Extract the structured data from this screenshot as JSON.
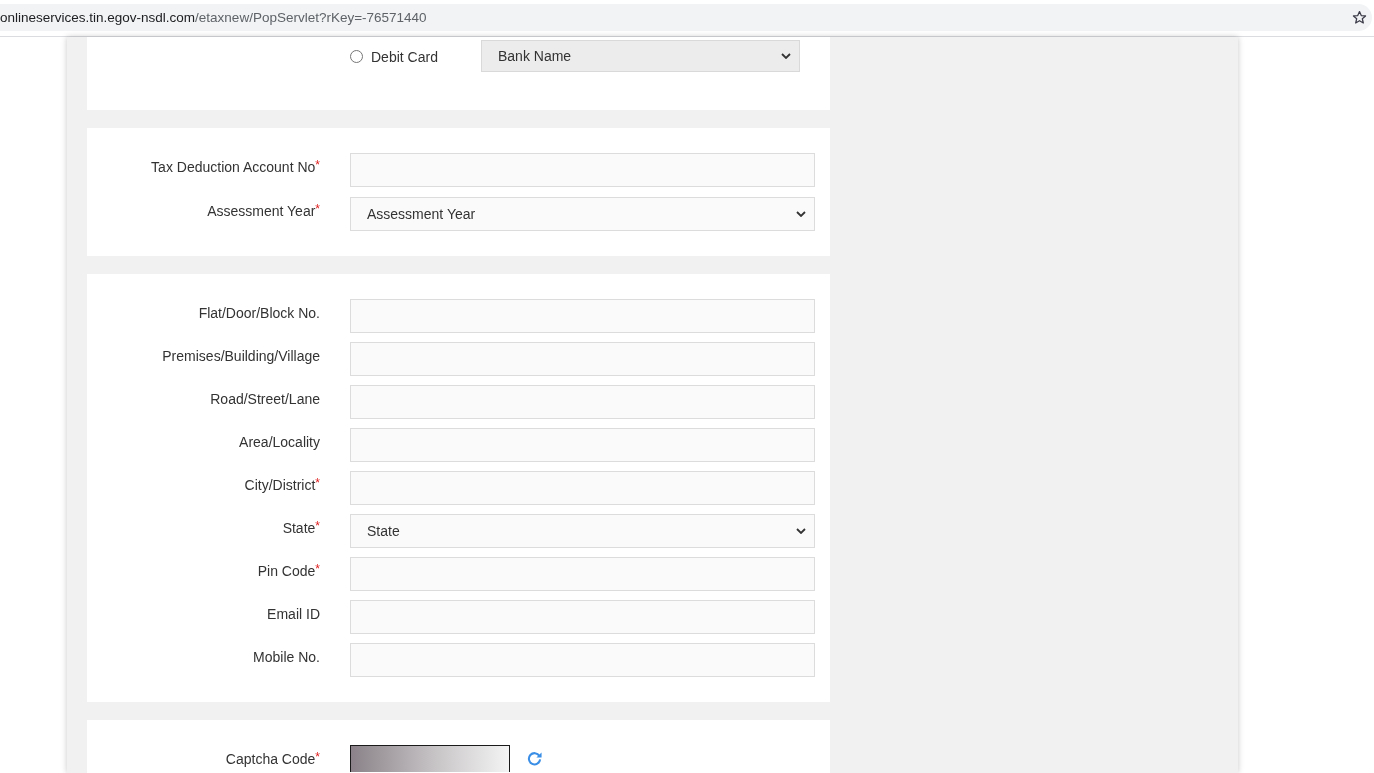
{
  "browser": {
    "url_host": "onlineservices.tin.egov-nsdl.com",
    "url_path": "/etaxnew/PopServlet?rKey=-76571440"
  },
  "payment": {
    "options": [
      {
        "label": "Debit Card",
        "selected": false
      }
    ],
    "bank_select": {
      "value": "Bank Name",
      "disabled": true
    }
  },
  "deductor": {
    "fields": [
      {
        "label": "Tax Deduction Account No",
        "required_mark": "*",
        "kind": "text"
      },
      {
        "label": "Assessment Year",
        "required_mark": "*",
        "kind": "select",
        "value": "Assessment Year"
      }
    ]
  },
  "address": {
    "fields": [
      {
        "label": "Flat/Door/Block No.",
        "kind": "text"
      },
      {
        "label": "Premises/Building/Village",
        "kind": "text"
      },
      {
        "label": "Road/Street/Lane",
        "kind": "text"
      },
      {
        "label": "Area/Locality",
        "kind": "text"
      },
      {
        "label": "City/District",
        "required_mark": "*",
        "kind": "text"
      },
      {
        "label": "State",
        "required_mark": "*",
        "kind": "select",
        "value": "State"
      },
      {
        "label": "Pin Code",
        "required_mark": "*",
        "kind": "text"
      },
      {
        "label": "Email ID",
        "kind": "text"
      },
      {
        "label": "Mobile No.",
        "kind": "text"
      }
    ]
  },
  "captcha": {
    "label": "Captcha Code",
    "required_mark": "*"
  }
}
